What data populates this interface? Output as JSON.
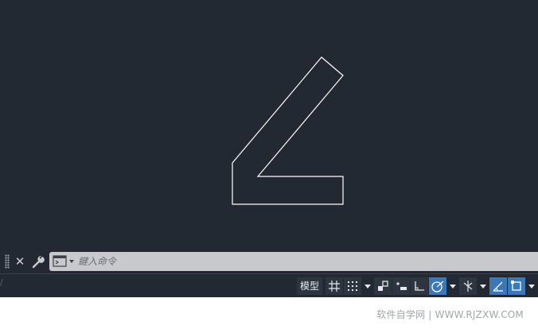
{
  "command_line": {
    "placeholder": "鍵入命令",
    "close_label": "✕"
  },
  "status_bar": {
    "model_label": "模型"
  },
  "footer": {
    "watermark": "软件自学网 | WWW.RJZXW.COM"
  },
  "colors": {
    "canvas_background": "#222933",
    "drawing_stroke": "#ffffff",
    "command_box": "#c7c9cc",
    "active_tool": "#3b78b8"
  },
  "icons": {
    "grip": "grip-icon",
    "close": "close-icon",
    "wrench": "wrench-icon",
    "prompt": "command-prompt-icon",
    "grid": "grid-icon",
    "snap": "snap-icon",
    "infer": "infer-constraints-icon",
    "dynamic_input": "dynamic-input-icon",
    "ortho": "ortho-icon",
    "polar": "polar-tracking-icon",
    "osnap": "object-snap-icon",
    "iso": "isodraft-icon",
    "selection_cycling": "selection-cycling-icon"
  }
}
